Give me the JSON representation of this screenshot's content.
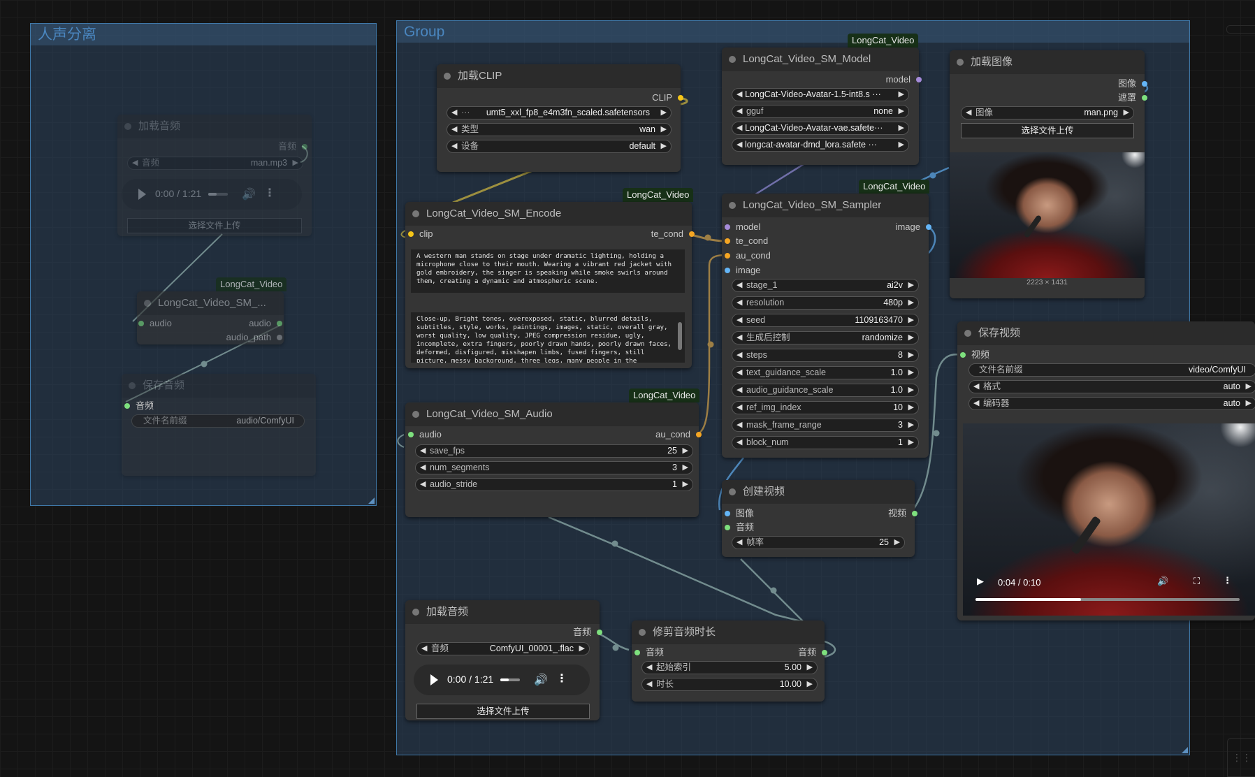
{
  "groups": {
    "left": {
      "title": "人声分离"
    },
    "main": {
      "title": "Group"
    }
  },
  "badges": {
    "longcat": "LongCat_Video"
  },
  "left_load_audio": {
    "title": "加载音频",
    "output_label": "音频",
    "widget_label": "音频",
    "widget_value": "man.mp3",
    "player_time": "0:00 / 1:21",
    "upload_label": "选择文件上传"
  },
  "left_sm_node": {
    "title": "LongCat_Video_SM_...",
    "input_audio": "audio",
    "output_audio": "audio",
    "output_audio_path": "audio_path"
  },
  "left_save_audio": {
    "title": "保存音频",
    "input_label": "音频",
    "widget_label": "文件名前缀",
    "widget_value": "audio/ComfyUI"
  },
  "load_clip": {
    "title": "加载CLIP",
    "output_label": "CLIP",
    "widgets": [
      {
        "label": "",
        "value": "umt5_xxl_fp8_e4m3fn_scaled.safetensors"
      },
      {
        "label": "类型",
        "value": "wan"
      },
      {
        "label": "设备",
        "value": "default"
      }
    ]
  },
  "model_node": {
    "title": "LongCat_Video_SM_Model",
    "output_label": "model",
    "widgets": [
      {
        "label": "",
        "value": "LongCat-Video-Avatar-1.5-int8.s ···"
      },
      {
        "label": "gguf",
        "value": "none"
      },
      {
        "label": "",
        "value": "LongCat-Video-Avatar-vae.safete···"
      },
      {
        "label": "",
        "value": "longcat-avatar-dmd_lora.safete ···"
      }
    ]
  },
  "load_image": {
    "title": "加载图像",
    "output_image": "图像",
    "output_mask": "遮罩",
    "widget_label": "图像",
    "widget_value": "man.png",
    "upload_label": "选择文件上传",
    "image_size": "2223 × 1431"
  },
  "encode_node": {
    "title": "LongCat_Video_SM_Encode",
    "input_clip": "clip",
    "output_te_cond": "te_cond",
    "prompt_positive": "A western man stands on stage under dramatic lighting, holding a microphone close to their mouth. Wearing a vibrant red jacket with gold embroidery, the singer is speaking while smoke swirls around them, creating a dynamic and atmospheric scene.",
    "prompt_negative": "Close-up, Bright tones, overexposed, static, blurred details, subtitles, style, works, paintings, images, static, overall gray, worst quality, low quality, JPEG compression residue, ugly, incomplete, extra fingers, poorly drawn hands, poorly drawn faces, deformed, disfigured, misshapen limbs, fused fingers, still picture, messy background, three legs, many people in the background, walking backwards"
  },
  "sampler_node": {
    "title": "LongCat_Video_SM_Sampler",
    "inputs": [
      "model",
      "te_cond",
      "au_cond",
      "image"
    ],
    "output_image": "image",
    "widgets": [
      {
        "label": "stage_1",
        "value": "ai2v"
      },
      {
        "label": "resolution",
        "value": "480p"
      },
      {
        "label": "seed",
        "value": "1109163470"
      },
      {
        "label": "生成后控制",
        "value": "randomize"
      },
      {
        "label": "steps",
        "value": "8"
      },
      {
        "label": "text_guidance_scale",
        "value": "1.0"
      },
      {
        "label": "audio_guidance_scale",
        "value": "1.0"
      },
      {
        "label": "ref_img_index",
        "value": "10"
      },
      {
        "label": "mask_frame_range",
        "value": "3"
      },
      {
        "label": "block_num",
        "value": "1"
      }
    ]
  },
  "save_video": {
    "title": "保存视频",
    "input_label": "视频",
    "widgets": [
      {
        "label": "文件名前缀",
        "value": "video/ComfyUI"
      },
      {
        "label": "格式",
        "value": "auto"
      },
      {
        "label": "编码器",
        "value": "auto"
      }
    ],
    "player_time": "0:04 / 0:10",
    "progress": 0.4
  },
  "audio_node": {
    "title": "LongCat_Video_SM_Audio",
    "input_audio": "audio",
    "output_au_cond": "au_cond",
    "widgets": [
      {
        "label": "save_fps",
        "value": "25"
      },
      {
        "label": "num_segments",
        "value": "3"
      },
      {
        "label": "audio_stride",
        "value": "1"
      }
    ]
  },
  "create_video": {
    "title": "创建视频",
    "input_image": "图像",
    "input_audio": "音频",
    "output_video": "视频",
    "widget_label": "帧率",
    "widget_value": "25"
  },
  "bottom_load_audio": {
    "title": "加载音频",
    "output_label": "音频",
    "widget_label": "音频",
    "widget_value": "ComfyUI_00001_.flac",
    "player_time": "0:00 / 1:21",
    "upload_label": "选择文件上传"
  },
  "trim_audio": {
    "title": "修剪音频时长",
    "input_label": "音频",
    "output_label": "音频",
    "widgets": [
      {
        "label": "起始索引",
        "value": "5.00"
      },
      {
        "label": "时长",
        "value": "10.00"
      }
    ]
  },
  "colors": {
    "link_clip": "#f5c518",
    "link_cond": "#f5a623",
    "link_model": "#a58bd9",
    "link_image": "#64b5f6",
    "link_audio": "#a8c0a8",
    "pin_audio": "#7ee07e",
    "group_border": "#3f78a8"
  }
}
